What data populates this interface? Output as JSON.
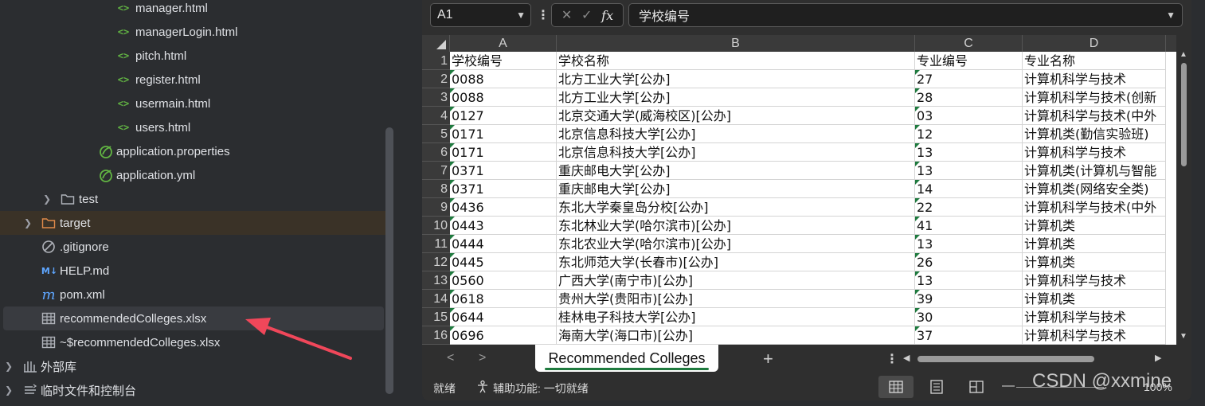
{
  "project_tree": {
    "items": [
      {
        "label": "manager.html",
        "icon": "html-icon"
      },
      {
        "label": "managerLogin.html",
        "icon": "html-icon"
      },
      {
        "label": "pitch.html",
        "icon": "html-icon"
      },
      {
        "label": "register.html",
        "icon": "html-icon"
      },
      {
        "label": "usermain.html",
        "icon": "html-icon"
      },
      {
        "label": "users.html",
        "icon": "html-icon"
      },
      {
        "label": "application.properties",
        "icon": "spring-leaf-icon"
      },
      {
        "label": "application.yml",
        "icon": "spring-leaf-icon"
      },
      {
        "label": "test",
        "icon": "folder-icon"
      },
      {
        "label": "target",
        "icon": "folder-icon"
      },
      {
        "label": ".gitignore",
        "icon": "ignore-icon"
      },
      {
        "label": "HELP.md",
        "icon": "markdown-icon",
        "icon_text": "M↓"
      },
      {
        "label": "pom.xml",
        "icon": "maven-icon",
        "icon_text": "m"
      },
      {
        "label": "recommendedColleges.xlsx",
        "icon": "table-icon"
      },
      {
        "label": "~$recommendedColleges.xlsx",
        "icon": "table-icon"
      },
      {
        "label": "外部库",
        "icon": "library-icon"
      },
      {
        "label": "临时文件和控制台",
        "icon": "console-icon"
      }
    ],
    "selected": "recommendedColleges.xlsx",
    "arrow_color": "#f0475a"
  },
  "excel": {
    "name_box": "A1",
    "formula_buttons": {
      "cancel": "✕",
      "enter": "✓",
      "fx": "fx"
    },
    "formula_value": "学校编号",
    "columns": [
      "A",
      "B",
      "C",
      "D"
    ],
    "rows": [
      {
        "n": "1",
        "a": "学校编号",
        "b": "学校名称",
        "c": "专业编号",
        "d": "专业名称"
      },
      {
        "n": "2",
        "a": "0088",
        "b": "北方工业大学[公办]",
        "c": "27",
        "d": "计算机科学与技术"
      },
      {
        "n": "3",
        "a": "0088",
        "b": "北方工业大学[公办]",
        "c": "28",
        "d": "计算机科学与技术(创新"
      },
      {
        "n": "4",
        "a": "0127",
        "b": "北京交通大学(威海校区)[公办]",
        "c": "03",
        "d": "计算机科学与技术(中外"
      },
      {
        "n": "5",
        "a": "0171",
        "b": "北京信息科技大学[公办]",
        "c": "12",
        "d": "计算机类(勤信实验班)"
      },
      {
        "n": "6",
        "a": "0171",
        "b": "北京信息科技大学[公办]",
        "c": "13",
        "d": "计算机科学与技术"
      },
      {
        "n": "7",
        "a": "0371",
        "b": "重庆邮电大学[公办]",
        "c": "13",
        "d": "计算机类(计算机与智能"
      },
      {
        "n": "8",
        "a": "0371",
        "b": "重庆邮电大学[公办]",
        "c": "14",
        "d": "计算机类(网络安全类)"
      },
      {
        "n": "9",
        "a": "0436",
        "b": "东北大学秦皇岛分校[公办]",
        "c": "22",
        "d": "计算机科学与技术(中外"
      },
      {
        "n": "10",
        "a": "0443",
        "b": "东北林业大学(哈尔滨市)[公办]",
        "c": "41",
        "d": "计算机类"
      },
      {
        "n": "11",
        "a": "0444",
        "b": "东北农业大学(哈尔滨市)[公办]",
        "c": "13",
        "d": "计算机类"
      },
      {
        "n": "12",
        "a": "0445",
        "b": "东北师范大学(长春市)[公办]",
        "c": "26",
        "d": "计算机类"
      },
      {
        "n": "13",
        "a": "0560",
        "b": "广西大学(南宁市)[公办]",
        "c": "13",
        "d": "计算机科学与技术"
      },
      {
        "n": "14",
        "a": "0618",
        "b": "贵州大学(贵阳市)[公办]",
        "c": "39",
        "d": "计算机类"
      },
      {
        "n": "15",
        "a": "0644",
        "b": "桂林电子科技大学[公办]",
        "c": "30",
        "d": "计算机科学与技术"
      },
      {
        "n": "16",
        "a": "0696",
        "b": "海南大学(海口市)[公办]",
        "c": "37",
        "d": "计算机科学与技术"
      }
    ],
    "sheet_tab": "Recommended Colleges",
    "add_sheet": "+",
    "status": {
      "ready": "就绪",
      "accessibility": "辅助功能: 一切就绪",
      "zoom": "100%"
    },
    "accent": "#1e7a3e"
  },
  "watermark": "CSDN @xxmine"
}
